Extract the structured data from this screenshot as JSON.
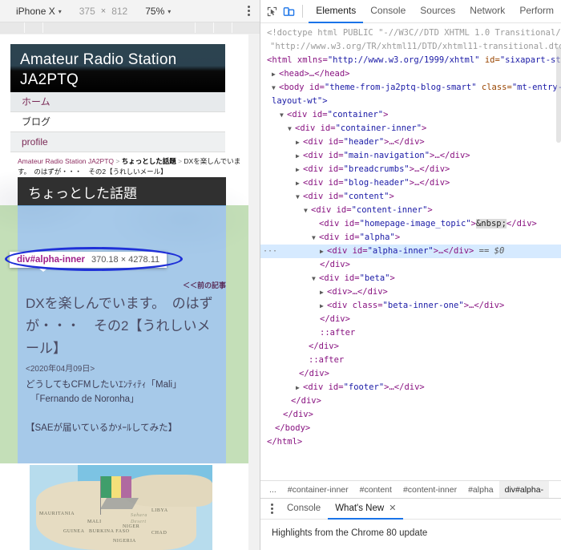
{
  "device_toolbar": {
    "device": "iPhone X",
    "width": "375",
    "times": "×",
    "height": "812",
    "zoom": "75%",
    "caret": "▾",
    "more_label": "More options"
  },
  "page": {
    "site_title_line1": "Amateur Radio Station",
    "site_title_line2": "JA2PTQ",
    "nav": [
      {
        "label": "ホーム"
      },
      {
        "label": "ブログ"
      },
      {
        "label": "profile"
      }
    ],
    "breadcrumb": {
      "root": "Amateur Radio Station JA2PTQ",
      "sep1": " > ",
      "category": "ちょっとした話題",
      "sep2": " > ",
      "current": "DXを楽しんでいます。　のはずが・・・　その2【うれしいメール】"
    },
    "category_banner": "ちょっとした話題",
    "prev_link": "＜＜前の記事",
    "post_title": "DXを楽しんでいます。　のはずが・・・　その2【うれしいメール】",
    "post_date": "<2020年04月09日>",
    "post_body_line1": "どうしてもCFMしたいｴﾝﾃｨﾃｨ「Mali」",
    "post_body_line2": "「Fernando de Noronha」",
    "post_body_line3": "【SAEが届いているかﾒｰﾙしてみた】",
    "image_labels": {
      "mauritania": "MAURITANIA",
      "mali": "MALI",
      "niger": "NIGER",
      "chad": "CHAD",
      "libya": "LIBYA",
      "nigeria": "NIGERIA",
      "guinea": "GUINEA",
      "sahara": "Sahara",
      "desert": "Desert",
      "burkina": "BURKINA FASO"
    }
  },
  "inspect_tooltip": {
    "selector": "div#alpha-inner",
    "size": "370.18 × 4278.11"
  },
  "devtools": {
    "icons": {
      "inspect": "inspect-cursor-icon",
      "device": "device-toolbar-icon"
    },
    "tabs": [
      {
        "label": "Elements",
        "active": true
      },
      {
        "label": "Console",
        "active": false
      },
      {
        "label": "Sources",
        "active": false
      },
      {
        "label": "Network",
        "active": false
      },
      {
        "label": "Perform",
        "active": false
      }
    ],
    "dom": {
      "l1": "<!doctype html PUBLIC \"-//W3C//DTD XHTML 1.0 Transitional/",
      "l2": "\"http://www.w3.org/TR/xhtml11/DTD/xhtml11-transitional.dtd\"",
      "l3_a": "<html xmlns=",
      "l3_b": "\"http://www.w3.org/1999/xhtml\"",
      "l3_c": " id=",
      "l3_d": "\"sixapart-st",
      "l4": "<head>…</head>",
      "l5_a": "<body id=",
      "l5_b": "\"theme-from-ja2ptq-blog-smart\"",
      "l5_c": " class=",
      "l5_d": "\"mt-entry-",
      "l6": "layout-wt\">",
      "l7_a": "<div id=",
      "l7_b": "\"container\"",
      "l7_c": ">",
      "l8_a": "<div id=",
      "l8_b": "\"container-inner\"",
      "l8_c": ">",
      "l9_a": "<div id=",
      "l9_b": "\"header\"",
      "l9_c": ">…</div>",
      "l10_a": "<div id=",
      "l10_b": "\"main-navigation\"",
      "l10_c": ">…</div>",
      "l11_a": "<div id=",
      "l11_b": "\"breadcrumbs\"",
      "l11_c": ">…</div>",
      "l12_a": "<div id=",
      "l12_b": "\"blog-header\"",
      "l12_c": ">…</div>",
      "l13_a": "<div id=",
      "l13_b": "\"content\"",
      "l13_c": ">",
      "l14_a": "<div id=",
      "l14_b": "\"content-inner\"",
      "l14_c": ">",
      "l15_a": "<div id=",
      "l15_b": "\"homepage-image_topic\"",
      "l15_c": ">",
      "l15_ent": "&nbsp;",
      "l15_d": "</div>",
      "l16_a": "<div id=",
      "l16_b": "\"alpha\"",
      "l16_c": ">",
      "l17_a": "<div id=",
      "l17_b": "\"alpha-inner\"",
      "l17_c": ">…</div>",
      "l17_d": " == $0",
      "l18": "</div>",
      "l19_a": "<div id=",
      "l19_b": "\"beta\"",
      "l19_c": ">",
      "l20": "<div>…</div>",
      "l21_a": "<div class=",
      "l21_b": "\"beta-inner-one\"",
      "l21_c": ">…</div>",
      "l22": "</div>",
      "l23": "::after",
      "l24": "</div>",
      "l25": "::after",
      "l26": "</div>",
      "l27_a": "<div id=",
      "l27_b": "\"footer\"",
      "l27_c": ">…</div>",
      "l28": "</div>",
      "l29": "</div>",
      "l30": "</body>",
      "l31": "</html>",
      "gutter_ellipsis": "···"
    },
    "breadcrumbs": [
      {
        "label": "...",
        "selected": false
      },
      {
        "label": "#container-inner",
        "selected": false
      },
      {
        "label": "#content",
        "selected": false
      },
      {
        "label": "#content-inner",
        "selected": false
      },
      {
        "label": "#alpha",
        "selected": false
      },
      {
        "label": "div#alpha-",
        "selected": true
      }
    ],
    "drawer": {
      "tabs": [
        {
          "label": "Console",
          "active": false,
          "closable": false
        },
        {
          "label": "What's New",
          "active": true,
          "closable": true
        }
      ],
      "close_glyph": "✕",
      "body": "Highlights from the Chrome 80 update"
    }
  },
  "annotations": {
    "tooltip_ellipse_color": "#1f30d8",
    "tree_ellipse_color": "#e01515"
  }
}
